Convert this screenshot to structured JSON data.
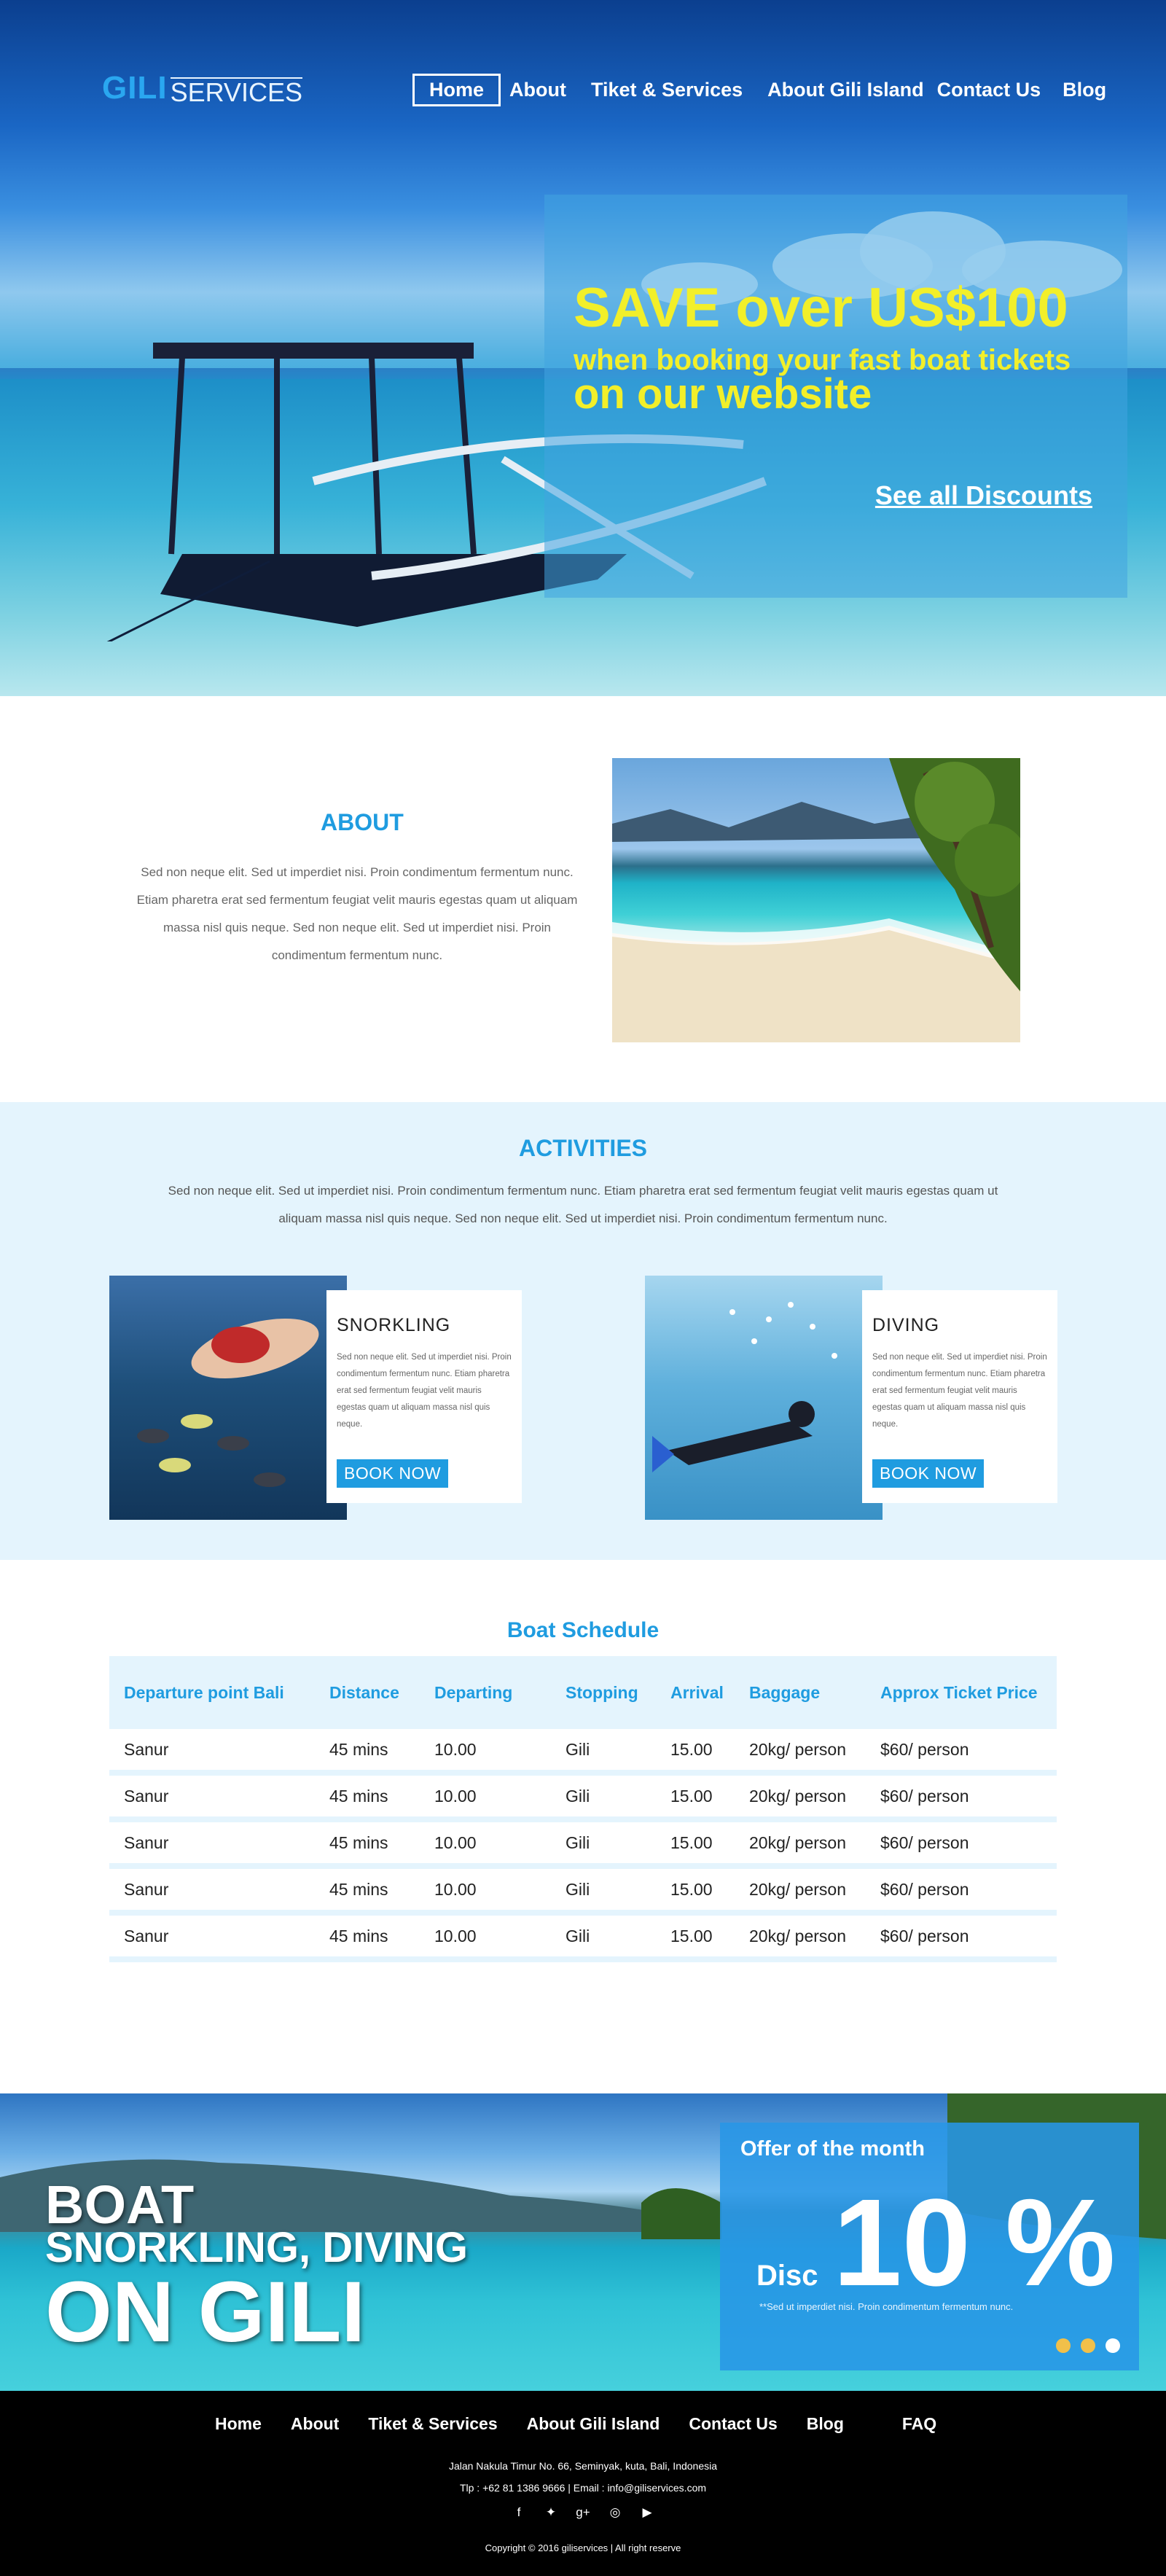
{
  "brand": {
    "logo_bold": "GILI",
    "logo_light": "SERVICES"
  },
  "nav": {
    "items": [
      {
        "label": "Home",
        "active": true
      },
      {
        "label": "About"
      },
      {
        "label": "Tiket & Services"
      },
      {
        "label": "About Gili Island"
      },
      {
        "label": "Contact Us"
      },
      {
        "label": "Blog"
      }
    ]
  },
  "hero": {
    "headline": "SAVE over US$100",
    "subline1": "when booking your fast boat tickets",
    "subline2": "on our website",
    "cta": "See all Discounts"
  },
  "about": {
    "title": "ABOUT",
    "text": "Sed non neque elit. Sed ut imperdiet nisi. Proin condimentum fermentum nunc. Etiam pharetra erat sed fermentum feugiat velit mauris egestas quam ut aliquam massa nisl quis neque. Sed non neque elit. Sed ut imperdiet nisi. Proin condimentum fermentum nunc."
  },
  "activities": {
    "title": "ACTIVITIES",
    "text": "Sed non neque elit. Sed ut imperdiet nisi. Proin condimentum fermentum nunc. Etiam pharetra erat sed fermentum feugiat velit mauris egestas quam ut aliquam massa nisl quis neque. Sed non neque elit. Sed ut imperdiet nisi. Proin condimentum fermentum nunc.",
    "cards": [
      {
        "title": "SNORKLING",
        "text": "Sed non neque elit. Sed ut imperdiet nisi. Proin condimentum fermentum nunc. Etiam pharetra erat sed fermentum feugiat velit mauris egestas quam ut aliquam massa nisl quis neque.",
        "button": "BOOK NOW"
      },
      {
        "title": "DIVING",
        "text": "Sed non neque elit. Sed ut imperdiet nisi. Proin condimentum fermentum nunc. Etiam pharetra erat sed fermentum feugiat velit mauris egestas quam ut aliquam massa nisl quis neque.",
        "button": "BOOK NOW"
      }
    ]
  },
  "schedule": {
    "title": "Boat Schedule",
    "headers": [
      "Departure point Bali",
      "Distance",
      "Departing",
      "Stopping",
      "Arrival",
      "Baggage",
      "Approx Ticket Price"
    ],
    "rows": [
      [
        "Sanur",
        "45 mins",
        "10.00",
        "Gili",
        "15.00",
        "20kg/ person",
        "$60/ person"
      ],
      [
        "Sanur",
        "45 mins",
        "10.00",
        "Gili",
        "15.00",
        "20kg/ person",
        "$60/ person"
      ],
      [
        "Sanur",
        "45 mins",
        "10.00",
        "Gili",
        "15.00",
        "20kg/ person",
        "$60/ person"
      ],
      [
        "Sanur",
        "45 mins",
        "10.00",
        "Gili",
        "15.00",
        "20kg/ person",
        "$60/ person"
      ],
      [
        "Sanur",
        "45 mins",
        "10.00",
        "Gili",
        "15.00",
        "20kg/ person",
        "$60/ person"
      ]
    ]
  },
  "banner": {
    "line1": "BOAT",
    "line2": "SNORKLING, DIVING",
    "line3": "ON GILI"
  },
  "offer": {
    "title": "Offer of the month",
    "disc_label": "Disc",
    "percent": "10 %",
    "note": "**Sed ut imperdiet nisi. Proin condimentum fermentum nunc.",
    "active_slide": 3
  },
  "footer": {
    "nav": [
      "Home",
      "About",
      "Tiket & Services",
      "About Gili Island",
      "Contact Us",
      "Blog",
      "FAQ"
    ],
    "address": "Jalan Nakula Timur No. 66, Seminyak, kuta, Bali, Indonesia",
    "contact": "Tlp    : +62 81 1386 9666      |      Email : info@giliservices.com",
    "social": [
      {
        "icon": "facebook-icon",
        "glyph": "f"
      },
      {
        "icon": "twitter-icon",
        "glyph": "🐦"
      },
      {
        "icon": "google-plus-icon",
        "glyph": "g+"
      },
      {
        "icon": "instagram-icon",
        "glyph": "◎"
      },
      {
        "icon": "youtube-icon",
        "glyph": "▶"
      }
    ],
    "copyright": "Copyright © 2016 giliservices  | All right reserve"
  },
  "colors": {
    "accent": "#1f9ce0",
    "promo_text": "#f2ef2a",
    "section_bg": "#e4f4fd",
    "dot": "#f1c04a"
  }
}
